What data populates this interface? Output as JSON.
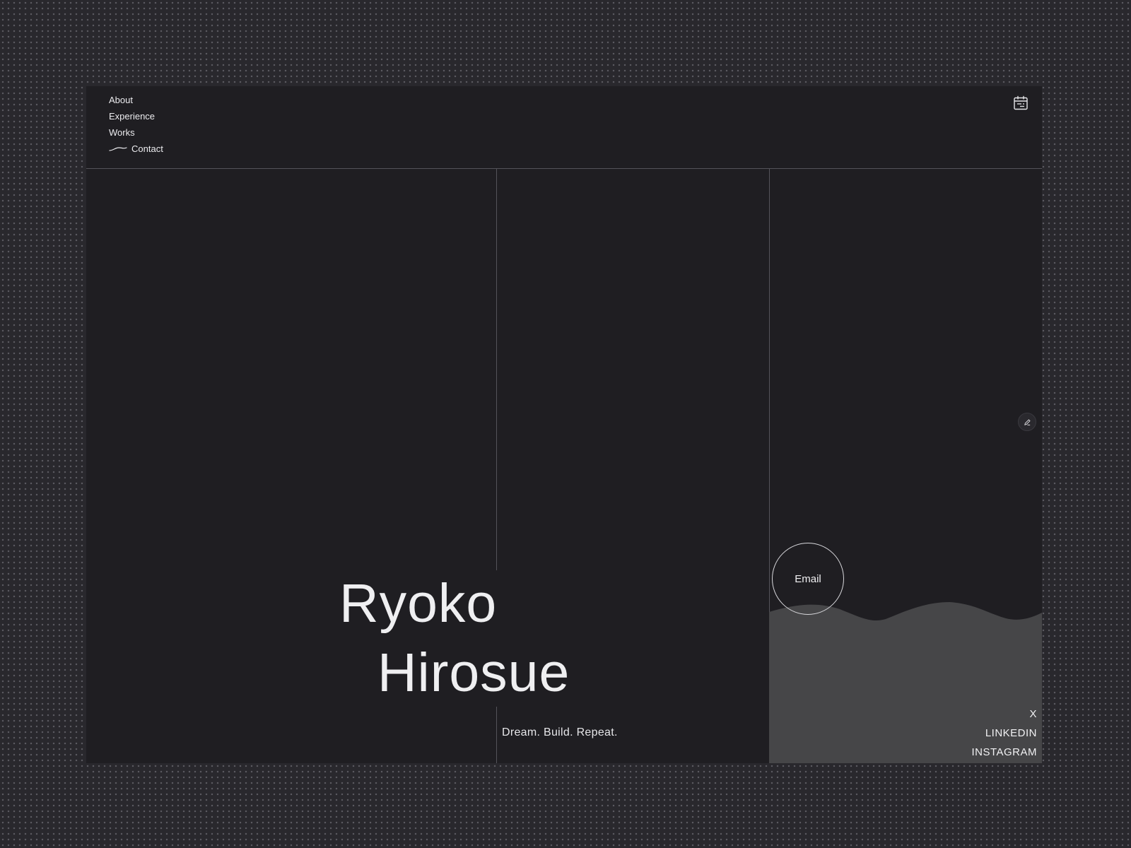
{
  "nav": {
    "items": [
      {
        "label": "About",
        "active": false
      },
      {
        "label": "Experience",
        "active": false
      },
      {
        "label": "Works",
        "active": false
      },
      {
        "label": "Contact",
        "active": true
      }
    ]
  },
  "header": {
    "calendar_icon": "calendar-icon"
  },
  "hero": {
    "first_name": "Ryoko",
    "last_name": "Hirosue",
    "tagline": "Dream. Build. Repeat."
  },
  "contact": {
    "email_label": "Email",
    "edit_icon": "pencil-icon",
    "socials": [
      "X",
      "LINKEDIN",
      "INSTAGRAM"
    ]
  },
  "colors": {
    "page_background": "#29282d",
    "frame_background": "#1f1e22",
    "rule_lines": "#54535a",
    "wave_fill": "#464648",
    "text": "#efeff1"
  }
}
